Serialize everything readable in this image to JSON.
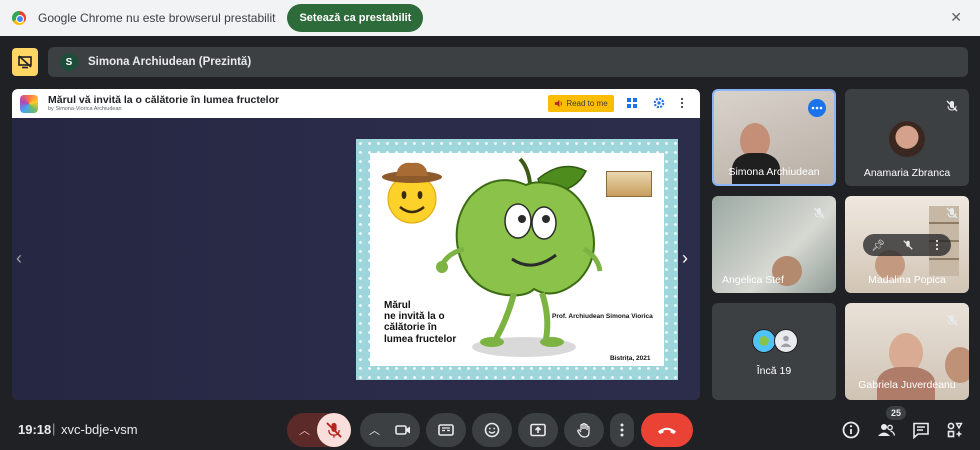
{
  "infobar": {
    "message": "Google Chrome nu este browserul prestabilit",
    "button_label": "Setează ca prestabilit"
  },
  "presenter": {
    "avatar_letter": "S",
    "label": "Simona Archiudean (Prezintă)"
  },
  "deck": {
    "title": "Mărul vă invită la o călătorie în lumea fructelor",
    "byline": "by Simona-Viorica Archiudean",
    "read_to_me": "Read to me",
    "slide_text": "Mărul\nne invită la o\ncălătorie în\nlumea fructelor",
    "slide_author": "Prof. Archiudean Simona Viorica",
    "slide_date": "Bistrița, 2021"
  },
  "tiles": {
    "simona": "Simona Archiudean",
    "anamaria": "Anamaria Zbranca",
    "angelica": "Angelica Stef",
    "madalina": "Madalina Popica",
    "more": "Încă 19",
    "gabriela": "Gabriela Juverdeanu"
  },
  "meeting": {
    "time": "19:18",
    "separator": "|",
    "code": "xvc-bdje-vsm",
    "participants_count": "25"
  },
  "colors": {
    "background": "#202124",
    "tile": "#3c4043",
    "end_call": "#ea4335",
    "mic_off": "#f9dedc",
    "infobar_button": "#2e6b3a",
    "active_border": "#8ab4f8",
    "read_button": "#fbbc04"
  }
}
